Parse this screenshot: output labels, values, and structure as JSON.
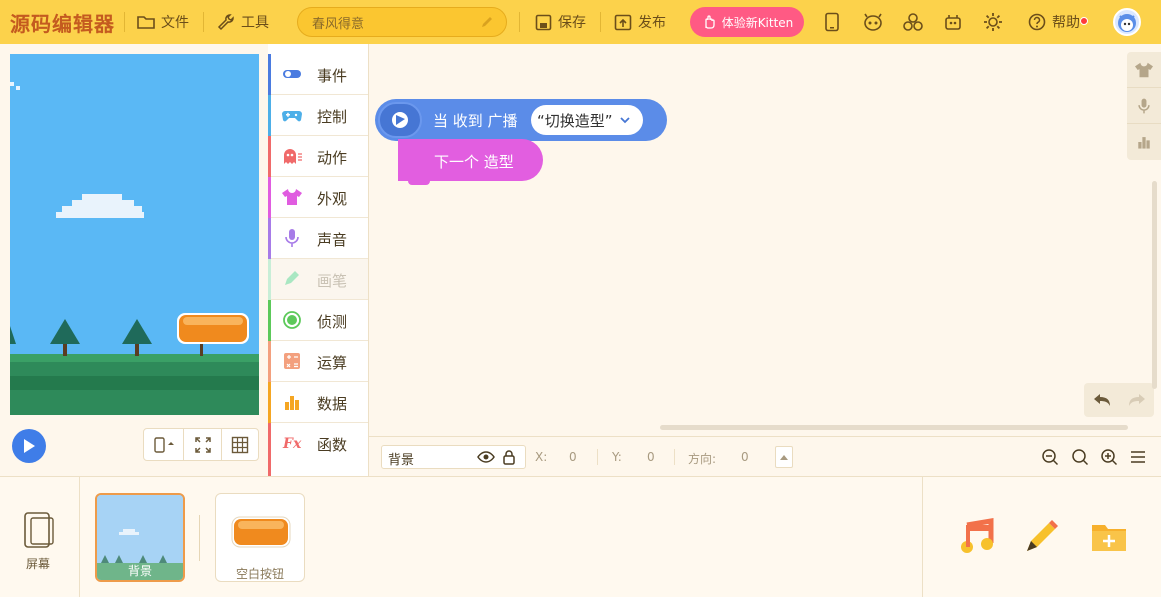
{
  "app": {
    "logo": "源码编辑器"
  },
  "toolbar": {
    "file_label": "文件",
    "tools_label": "工具",
    "project_name": "春风得意",
    "save_label": "保存",
    "publish_label": "发布",
    "kitten_label": "体验新Kitten",
    "help_label": "帮助"
  },
  "categories": [
    {
      "label": "事件",
      "color": "#4a7be0"
    },
    {
      "label": "控制",
      "color": "#4dafe8"
    },
    {
      "label": "动作",
      "color": "#f06a6a"
    },
    {
      "label": "外观",
      "color": "#e05ce0"
    },
    {
      "label": "声音",
      "color": "#a77be8"
    },
    {
      "label": "画笔",
      "color": "#6fd99a"
    },
    {
      "label": "侦测",
      "color": "#5cc95a"
    },
    {
      "label": "运算",
      "color": "#f3a07e"
    },
    {
      "label": "数据",
      "color": "#f5a623"
    },
    {
      "label": "函数",
      "color": "#f06a6a"
    }
  ],
  "blocks": {
    "hat_text": "当 收到 广播",
    "hat_value": "“切换造型”",
    "cmd_text": "下一个 造型"
  },
  "infobar": {
    "sprite_name": "背景",
    "x_label": "X:",
    "x_value": "0",
    "y_label": "Y:",
    "y_value": "0",
    "dir_label": "方向:",
    "dir_value": "0"
  },
  "bottom": {
    "screen_label": "屏幕",
    "background_label": "背景",
    "sprite_label": "空白按钮"
  }
}
